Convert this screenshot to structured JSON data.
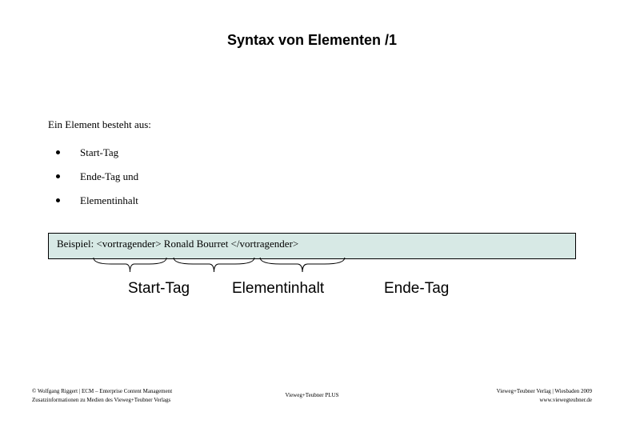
{
  "title": "Syntax von Elementen /1",
  "intro": "Ein Element besteht aus:",
  "bullets": [
    "Start-Tag",
    "Ende-Tag und",
    "Elementinhalt"
  ],
  "example_prefix": "Beispiel: ",
  "example_code": "<vortragender> Ronald Bourret </vortragender>",
  "labels": {
    "start": "Start-Tag",
    "content": "Elementinhalt",
    "end": "Ende-Tag"
  },
  "footer": {
    "left_line1": "© Wolfgang Riggert | ECM – Enterprise Content Management",
    "left_line2": "Zusatzinformationen zu Medien des Vieweg+Teubner Verlags",
    "center": "Vieweg+Teubner PLUS",
    "right_line1": "Vieweg+Teubner Verlag | Wiesbaden 2009",
    "right_line2": "www.viewegteubner.de"
  }
}
